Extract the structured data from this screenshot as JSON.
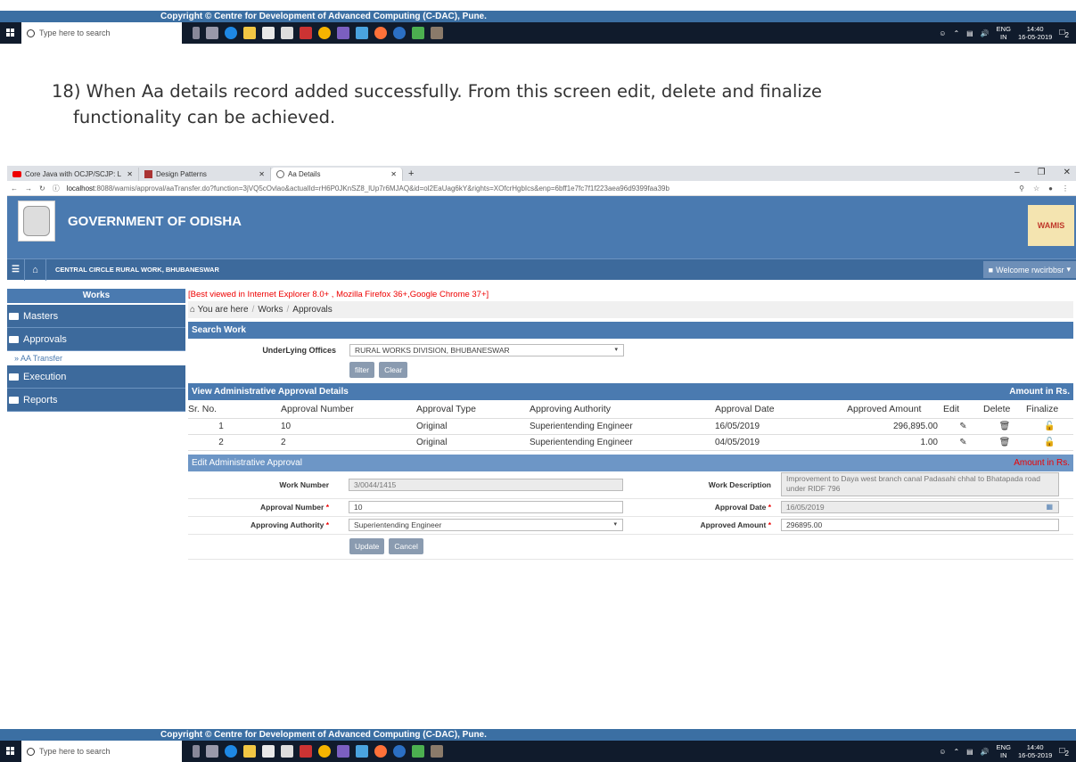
{
  "copyright": "Copyright © Centre for Development of Advanced Computing (C-DAC), Pune.",
  "taskbar": {
    "search_placeholder": "Type here to search",
    "lang": "ENG",
    "lang_region": "IN",
    "time": "14:40",
    "date": "16-05-2019",
    "notif_count": "2"
  },
  "doc": {
    "step_text": "18) When Aa details record added successfully. From this screen edit, delete and finalize",
    "step_text_cont": "functionality can be achieved."
  },
  "browser": {
    "tabs": [
      {
        "label": "Core Java with OCJP/SCJP: L",
        "active": false
      },
      {
        "label": "Design Patterns",
        "active": false
      },
      {
        "label": "Aa Details",
        "active": true
      }
    ],
    "url_host": "localhost",
    "url_rest": ":8088/wamis/approval/aaTransfer.do?function=3jVQ5cOvlao&actualId=rH6P0JKnSZ8_lUp7r6MJAQ&id=ol2EaUag6kY&rights=XOfcrHgbIcs&enp=6bff1e7fc7f1f223aea96d9399faa39b"
  },
  "app": {
    "title": "GOVERNMENT OF ODISHA",
    "logo_text": "WAMIS",
    "office": "CENTRAL CIRCLE RURAL WORK, BHUBANESWAR",
    "welcome": "Welcome rwcirbbsr"
  },
  "sidebar": {
    "header": "Works",
    "items": [
      {
        "label": "Masters"
      },
      {
        "label": "Approvals"
      },
      {
        "label": "Execution"
      },
      {
        "label": "Reports"
      }
    ],
    "sub_item": "» AA Transfer"
  },
  "main": {
    "best_viewed": "[Best viewed in Internet Explorer 8.0+ , Mozilla Firefox 36+,Google Chrome 37+]",
    "breadcrumb": {
      "prefix": "You are here",
      "items": [
        "Works",
        "Approvals"
      ]
    },
    "search": {
      "header": "Search Work",
      "label": "UnderLying Offices",
      "value": "RURAL WORKS DIVISION, BHUBANESWAR",
      "filter": "filter",
      "clear": "Clear"
    },
    "view": {
      "header": "View Administrative Approval Details",
      "amount_note": "Amount in Rs.",
      "columns": [
        "Sr. No.",
        "Approval Number",
        "Approval Type",
        "Approving Authority",
        "Approval Date",
        "Approved Amount",
        "Edit",
        "Delete",
        "Finalize"
      ],
      "rows": [
        {
          "sr": "1",
          "number": "10",
          "type": "Original",
          "authority": "Superientending Engineer",
          "date": "16/05/2019",
          "amount": "296,895.00"
        },
        {
          "sr": "2",
          "number": "2",
          "type": "Original",
          "authority": "Superientending Engineer",
          "date": "04/05/2019",
          "amount": "1.00"
        }
      ]
    },
    "edit": {
      "header": "Edit Administrative Approval",
      "amount_note": "Amount in Rs.",
      "work_number_label": "Work Number",
      "work_number": "3/0044/1415",
      "work_desc_label": "Work Description",
      "work_desc": "Improvement to Daya west branch canal Padasahi chhal to Bhatapada road under RIDF 796",
      "approval_number_label": "Approval Number",
      "approval_number": "10",
      "approval_date_label": "Approval Date",
      "approval_date": "16/05/2019",
      "authority_label": "Approving Authority",
      "authority": "Superientending Engineer",
      "amount_label": "Approved Amount",
      "amount": "296895.00",
      "update": "Update",
      "cancel": "Cancel"
    }
  }
}
